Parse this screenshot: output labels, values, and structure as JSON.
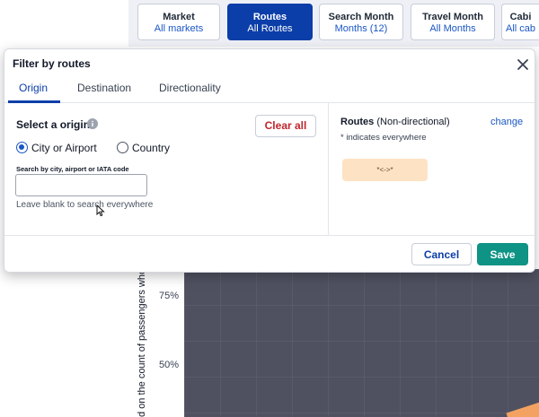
{
  "filters": [
    {
      "title": "Market",
      "value": "All markets",
      "active": false
    },
    {
      "title": "Routes",
      "value": "All Routes",
      "active": true
    },
    {
      "title": "Search Month",
      "value": "Months (12)",
      "active": false
    },
    {
      "title": "Travel Month",
      "value": "All Months",
      "active": false
    },
    {
      "title": "Cabi",
      "value": "All cab",
      "active": false
    }
  ],
  "chart": {
    "y_ticks": [
      "75%",
      "50%"
    ],
    "ylabel": "d on the count of passengers who re"
  },
  "modal": {
    "title": "Filter by routes",
    "tabs": [
      "Origin",
      "Destination",
      "Directionality"
    ],
    "active_tab": "Origin",
    "select_label": "Select a origin",
    "clear_label": "Clear all",
    "radio_options": [
      "City or Airport",
      "Country"
    ],
    "selected_radio": "City or Airport",
    "search_label": "Search by city, airport or IATA code",
    "search_value": "",
    "search_hint": "Leave blank to search everywhere",
    "routes_title": "Routes",
    "routes_subtitle": "(Non-directional)",
    "change_label": "change",
    "routes_note": "* indicates everywhere",
    "route_chip": "*<->*",
    "cancel_label": "Cancel",
    "save_label": "Save"
  },
  "colors": {
    "primary": "#0b3ea8",
    "link": "#1a56c4",
    "save": "#0e9384",
    "danger": "#c0262d",
    "chip": "#fde3c4"
  }
}
